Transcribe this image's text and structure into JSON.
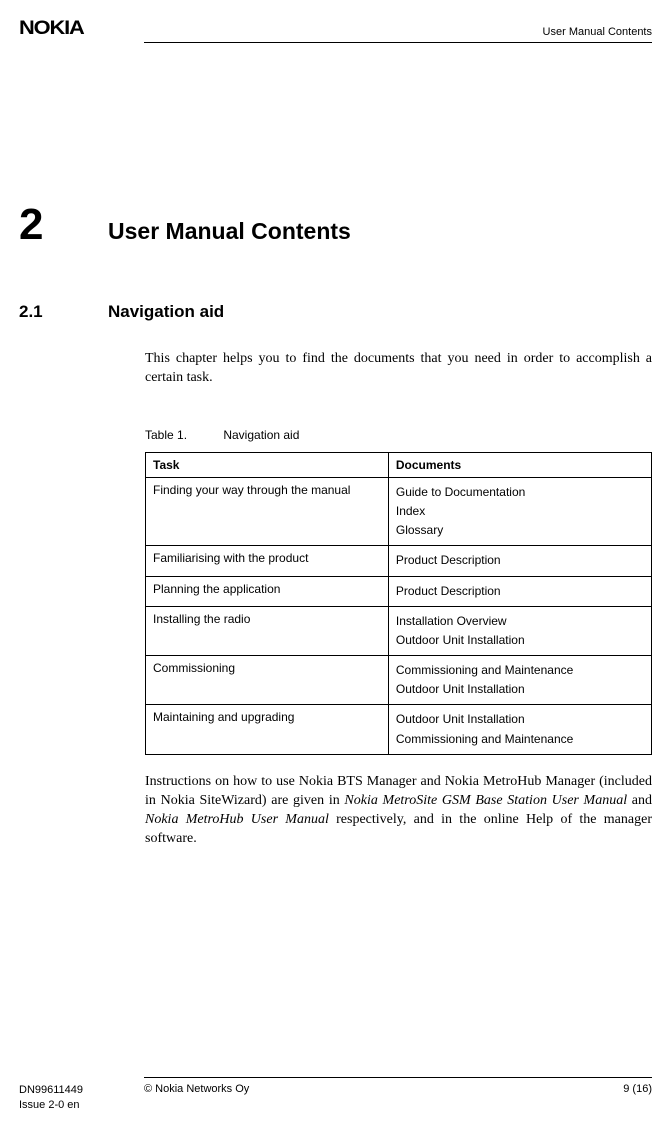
{
  "header": {
    "logo": "NOKIA",
    "manual_title": "User Manual Contents"
  },
  "chapter": {
    "number": "2",
    "title": "User Manual Contents"
  },
  "section": {
    "number": "2.1",
    "title": "Navigation aid",
    "intro": "This chapter helps you to find the documents that you need in order to accomplish a certain task."
  },
  "table": {
    "label": "Table 1.",
    "caption": "Navigation aid",
    "headers": {
      "task": "Task",
      "documents": "Documents"
    },
    "rows": [
      {
        "task": "Finding your way through the manual",
        "docs": [
          "Guide to Documentation",
          "Index",
          "Glossary"
        ]
      },
      {
        "task": "Familiarising with the product",
        "docs": [
          "Product Description"
        ]
      },
      {
        "task": "Planning the application",
        "docs": [
          "Product Description"
        ]
      },
      {
        "task": "Installing the radio",
        "docs": [
          "Installation Overview",
          "Outdoor Unit Installation"
        ]
      },
      {
        "task": "Commissioning",
        "docs": [
          "Commissioning and Maintenance",
          "Outdoor Unit Installation"
        ]
      },
      {
        "task": "Maintaining and upgrading",
        "docs": [
          "Outdoor Unit Installation",
          "Commissioning and Maintenance"
        ]
      }
    ]
  },
  "after_table": {
    "p1_part1": "Instructions on how to use Nokia BTS Manager and Nokia MetroHub Manager (included in Nokia SiteWizard) are given in ",
    "p1_italic1": "Nokia MetroSite GSM Base Station User Manual",
    "p1_part2": " and ",
    "p1_italic2": "Nokia MetroHub User Manual",
    "p1_part3": " respectively, and in the online Help of the manager software."
  },
  "footer": {
    "doc_id": "DN99611449",
    "issue": "Issue 2-0 en",
    "copyright": "© Nokia Networks Oy",
    "page": "9 (16)"
  }
}
